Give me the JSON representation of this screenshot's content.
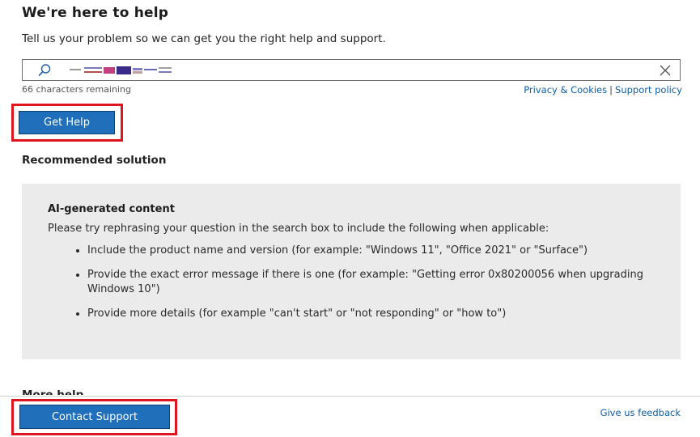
{
  "header": {
    "title": "We're here to help",
    "subtitle": "Tell us your problem so we can get you the right help and support."
  },
  "search": {
    "icon": "search-icon",
    "clear_icon": "close-icon",
    "characters_remaining": "66 characters remaining"
  },
  "links": {
    "privacy": "Privacy & Cookies",
    "separator": "|",
    "support_policy": "Support policy"
  },
  "buttons": {
    "get_help": "Get Help",
    "contact_support": "Contact Support"
  },
  "recommended": {
    "heading": "Recommended solution",
    "ai_title": "AI-generated content",
    "intro": "Please try rephrasing your question in the search box to include the following when applicable:",
    "bullets": [
      "Include the product name and version (for example: \"Windows 11\", \"Office 2021\" or \"Surface\")",
      "Provide the exact error message if there is one (for example: \"Getting error 0x80200056 when upgrading Windows 10\")",
      "Provide more details (for example \"can't start\" or \"not responding\" or \"how to\")"
    ]
  },
  "more_help": "More help",
  "footer": {
    "feedback": "Give us feedback"
  },
  "colors": {
    "accent": "#1f6fba",
    "link": "#0f5ea8",
    "highlight": "#e0141e",
    "panel": "#ebebeb"
  }
}
